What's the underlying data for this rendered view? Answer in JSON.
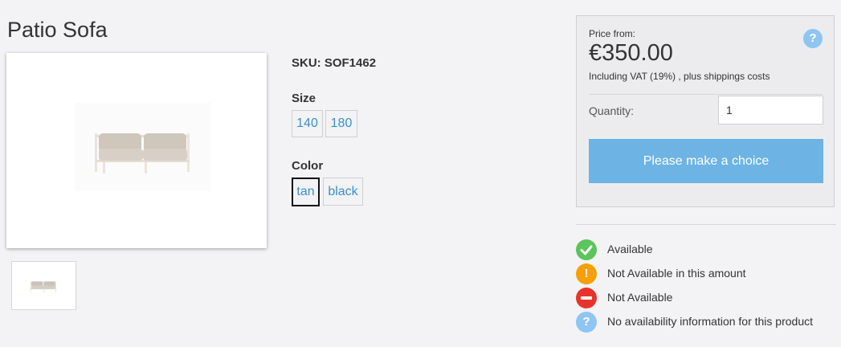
{
  "product": {
    "title": "Patio Sofa",
    "sku_label": "SKU: SOF1462"
  },
  "options": {
    "size": {
      "label": "Size",
      "values": [
        "140",
        "180"
      ]
    },
    "color": {
      "label": "Color",
      "values": [
        "tan",
        "black"
      ],
      "selected": "tan"
    }
  },
  "pricing": {
    "price_from_label": "Price from:",
    "price": "€350.00",
    "vat_text": "Including VAT (19%) , plus shippings costs",
    "help_icon": "question-icon",
    "quantity_label": "Quantity:",
    "quantity_value": "1",
    "choice_button_label": "Please make a choice"
  },
  "availability_legend": [
    {
      "icon": "check-icon",
      "color": "#5cc45c",
      "text": "Available"
    },
    {
      "icon": "exclamation-icon",
      "color": "#f5a00b",
      "text": "Not Available in this amount"
    },
    {
      "icon": "minus-icon",
      "color": "#e8332b",
      "text": "Not Available"
    },
    {
      "icon": "question-icon",
      "color": "#8ec5f2",
      "text": "No availability information for this product"
    }
  ],
  "colors": {
    "accent": "#3a8fd0",
    "button": "#6db3e4"
  }
}
